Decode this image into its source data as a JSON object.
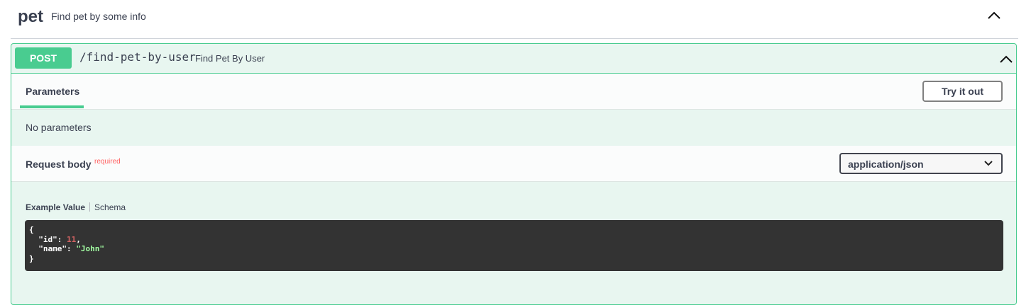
{
  "tag": {
    "name": "pet",
    "description": "Find pet by some info"
  },
  "operation": {
    "method": "POST",
    "path": "/find-pet-by-user",
    "summary": "Find Pet By User",
    "method_color": "#49cc90"
  },
  "parameters": {
    "tab_label": "Parameters",
    "try_it_out_label": "Try it out",
    "empty_text": "No parameters"
  },
  "request_body": {
    "title": "Request body",
    "required_label": "required",
    "content_type": "application/json"
  },
  "example": {
    "tab_example": "Example Value",
    "tab_schema": "Schema",
    "open_brace": "{",
    "id_key": "\"id\"",
    "id_value": "11",
    "name_key": "\"name\"",
    "name_value": "\"John\"",
    "close_brace": "}"
  }
}
